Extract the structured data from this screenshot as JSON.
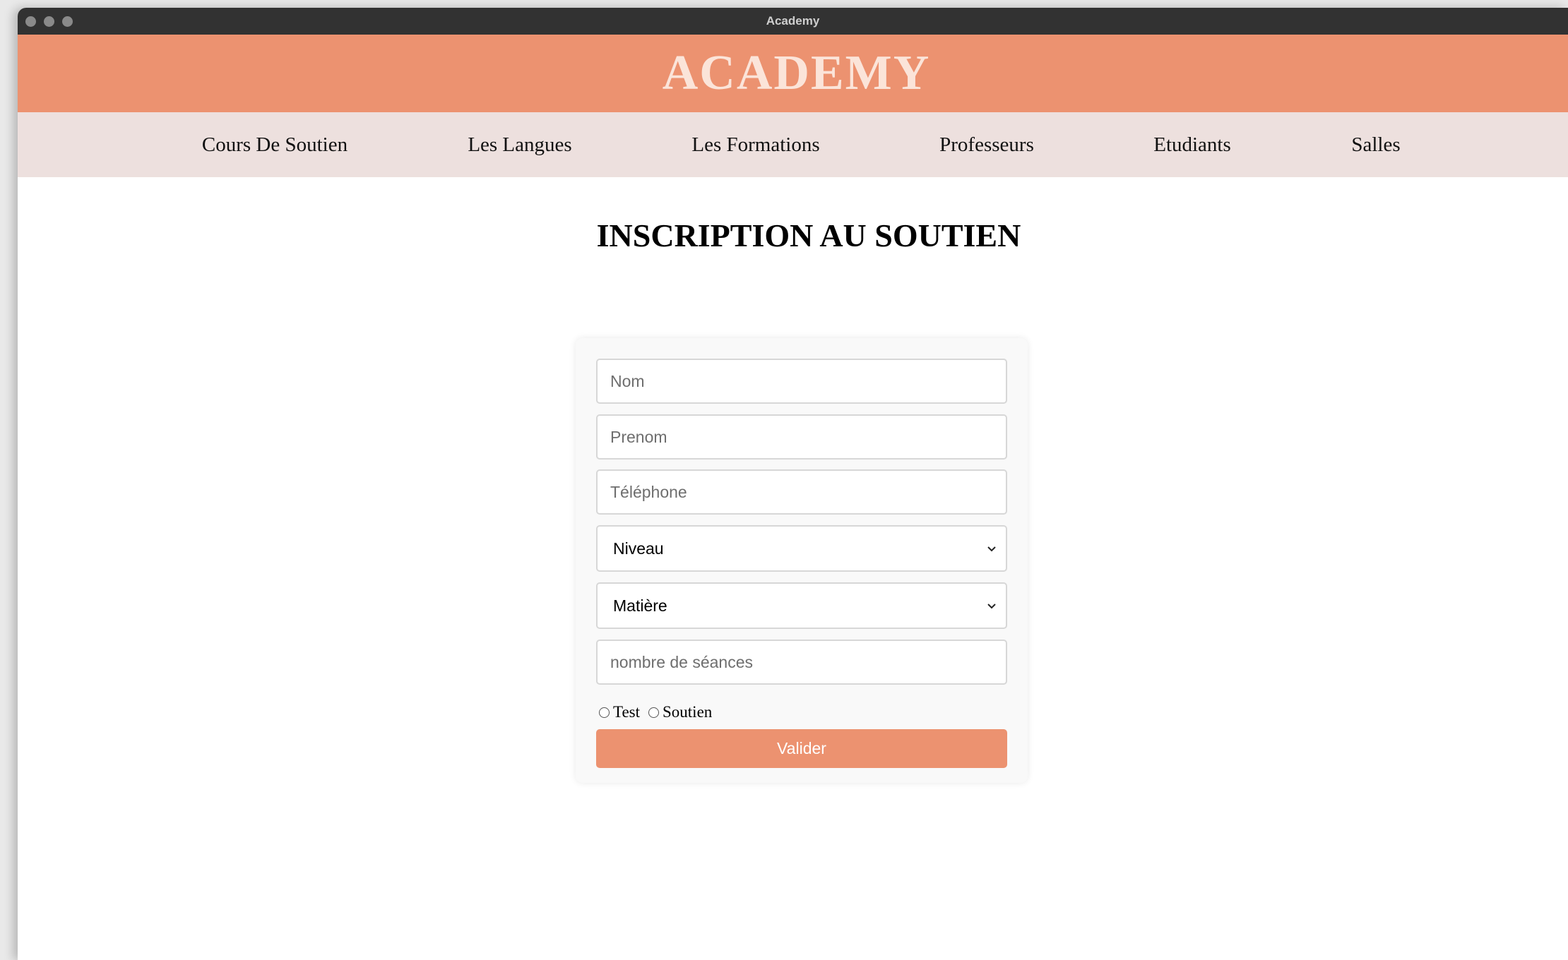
{
  "window": {
    "title": "Academy"
  },
  "header": {
    "brand": "ACADEMY"
  },
  "nav": {
    "items": [
      {
        "label": "Cours De Soutien"
      },
      {
        "label": "Les Langues"
      },
      {
        "label": "Les Formations"
      },
      {
        "label": "Professeurs"
      },
      {
        "label": "Etudiants"
      },
      {
        "label": "Salles"
      }
    ]
  },
  "main": {
    "title": "INSCRIPTION AU SOUTIEN"
  },
  "form": {
    "nom_placeholder": "Nom",
    "prenom_placeholder": "Prenom",
    "telephone_placeholder": "Téléphone",
    "niveau_selected": "Niveau",
    "matiere_selected": "Matière",
    "seances_placeholder": "nombre de séances",
    "radio_test_label": "Test",
    "radio_soutien_label": "Soutien",
    "submit_label": "Valider"
  },
  "colors": {
    "accent": "#ec9270",
    "nav_background": "#ede0de",
    "titlebar": "#323232"
  },
  "icons": {
    "select_arrow": "chevron-down-icon",
    "window_controls": "traffic-light-icon"
  }
}
